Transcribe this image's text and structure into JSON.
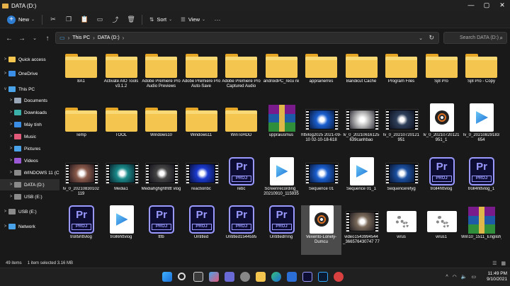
{
  "window": {
    "title": "DATA (D:)",
    "minimize": "—",
    "maximize": "▢",
    "close": "✕"
  },
  "toolbar": {
    "new_label": "New",
    "sort_label": "Sort",
    "view_label": "View",
    "more": "···"
  },
  "address": {
    "crumbs": [
      "This PC",
      "DATA (D:)"
    ],
    "search_placeholder": "Search DATA (D:)"
  },
  "sidebar": [
    {
      "label": "Quick access",
      "icon": "star-icon",
      "color": "#f5c64f",
      "chev": ">"
    },
    {
      "label": "OneDrive",
      "icon": "cloud-icon",
      "color": "#3a8ee6",
      "chev": ">"
    },
    {
      "label": "This PC",
      "icon": "pc-icon",
      "color": "#4aa3e8",
      "chev": "v"
    },
    {
      "label": "Documents",
      "icon": "documents-icon",
      "color": "#9aa7b8",
      "chev": ">"
    },
    {
      "label": "Downloads",
      "icon": "download-icon",
      "color": "#3ab0a8",
      "chev": ">"
    },
    {
      "label": "Máy tính",
      "icon": "desktop-icon",
      "color": "#3a8ee6",
      "chev": ">"
    },
    {
      "label": "Music",
      "icon": "music-icon",
      "color": "#e25a7a",
      "chev": ">"
    },
    {
      "label": "Pictures",
      "icon": "pictures-icon",
      "color": "#4aa3e8",
      "chev": ">"
    },
    {
      "label": "Videos",
      "icon": "videos-icon",
      "color": "#9b59d6",
      "chev": ">"
    },
    {
      "label": "WINDOWS 11 (C:",
      "icon": "drive-icon",
      "color": "#8a8a8a",
      "chev": ">"
    },
    {
      "label": "DATA (D:)",
      "icon": "drive-icon",
      "color": "#8a8a8a",
      "chev": ">",
      "selected": true
    },
    {
      "label": "USB (E:)",
      "icon": "usb-drive-icon",
      "color": "#8a8a8a",
      "chev": ">"
    },
    {
      "label": "USB (E:)",
      "icon": "usb-drive-icon",
      "color": "#8a8a8a",
      "chev": ">"
    },
    {
      "label": "Network",
      "icon": "network-icon",
      "color": "#4aa3e8",
      "chev": ">"
    }
  ],
  "files": [
    {
      "name": "8A1",
      "kind": "folder"
    },
    {
      "name": "Activate AIO Tools v3.1.2",
      "kind": "folder"
    },
    {
      "name": "Adobe Premiere Pro Audio Previews",
      "kind": "folder"
    },
    {
      "name": "Adobe Premiere Pro Auto-Save",
      "kind": "folder"
    },
    {
      "name": "Adobe Premiere Pro Captured Audio",
      "kind": "folder"
    },
    {
      "name": "androidPC_recu re",
      "kind": "folder"
    },
    {
      "name": "apprainerres",
      "kind": "folder"
    },
    {
      "name": "Bandicut Cache",
      "kind": "folder"
    },
    {
      "name": "Program Files",
      "kind": "folder"
    },
    {
      "name": "Sj8 Pro",
      "kind": "folder"
    },
    {
      "name": "Sj8 Pro - Copy",
      "kind": "folder"
    },
    {
      "name": "Temp",
      "kind": "folder"
    },
    {
      "name": "TOOL",
      "kind": "folder"
    },
    {
      "name": "Windows10",
      "kind": "folder"
    },
    {
      "name": "Windows11",
      "kind": "folder"
    },
    {
      "name": "WinToHDD",
      "kind": "folder"
    },
    {
      "name": "uppraiusmus",
      "kind": "rar"
    },
    {
      "name": "httvlog2025 2021-09-10 02-10-18-618",
      "kind": "film",
      "tint": "#1a5fd0"
    },
    {
      "name": "lv_0_20210616125 639canhbao",
      "kind": "film",
      "tint": "#c9c9c9"
    },
    {
      "name": "lv_0_20210720121 951",
      "kind": "film",
      "tint": "#2e3f5a"
    },
    {
      "name": "lv_0_20210720121 951_1",
      "kind": "vlc"
    },
    {
      "name": "lv_0_20210829183 654",
      "kind": "videoicon"
    },
    {
      "name": "lv_0_20210830102 119",
      "kind": "film",
      "tint": "#8a5a4a"
    },
    {
      "name": "Media1",
      "kind": "film",
      "tint": "#1a8a8a"
    },
    {
      "name": "Mediahghghthttt vlog",
      "kind": "film",
      "tint": "#444444"
    },
    {
      "name": "reactionbc",
      "kind": "film",
      "tint": "#1a3ad0"
    },
    {
      "name": "rebc",
      "kind": "prproj"
    },
    {
      "name": "Screenrecording_ 20210910_115935",
      "kind": "videoicon"
    },
    {
      "name": "Sequence 01",
      "kind": "film",
      "tint": "#1a5fd0"
    },
    {
      "name": "Sequence 01_1",
      "kind": "videoicon"
    },
    {
      "name": "Sequencerefyg",
      "kind": "film",
      "tint": "#1a4fa0"
    },
    {
      "name": "troll4httvlog",
      "kind": "prproj"
    },
    {
      "name": "troll4httvlog_1",
      "kind": "prproj"
    },
    {
      "name": "troll5httvlog",
      "kind": "prproj"
    },
    {
      "name": "troll6httvlog",
      "kind": "videoicon"
    },
    {
      "name": "ttfb",
      "kind": "prproj"
    },
    {
      "name": "Untitled",
      "kind": "prproj"
    },
    {
      "name": "Untitled1544595",
      "kind": "prproj"
    },
    {
      "name": "Untitledrnng",
      "kind": "prproj"
    },
    {
      "name": "Vexento-Lonely-Dumcu",
      "kind": "vlc",
      "selected": true
    },
    {
      "name": "video1543994544 _366576430747 77",
      "kind": "film",
      "tint": "#7a6a5a"
    },
    {
      "name": "virus",
      "kind": "gear"
    },
    {
      "name": "virus1",
      "kind": "gear"
    },
    {
      "name": "Win10_1511_English_x64",
      "kind": "rar"
    }
  ],
  "status": {
    "count": "49 items",
    "selected": "1 item selected  3.16 MB"
  },
  "taskbar": {
    "time": "11:49 PM",
    "date": "9/10/2021",
    "tray_lang": "ENG"
  }
}
